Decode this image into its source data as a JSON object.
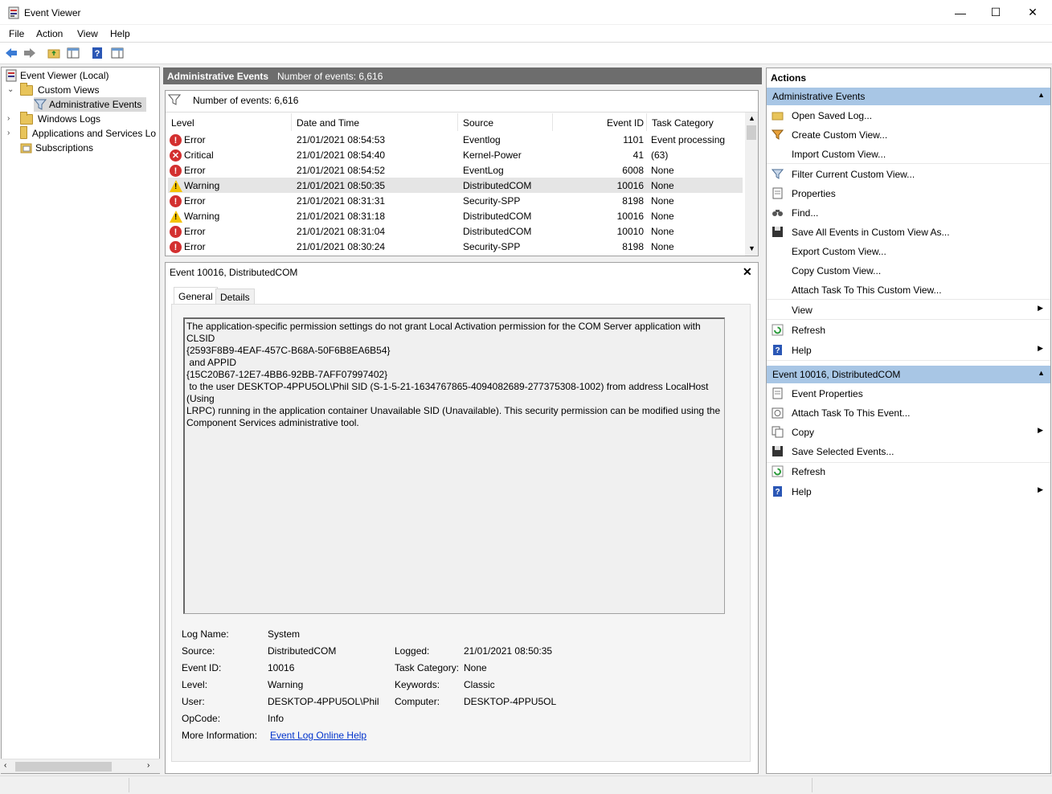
{
  "window": {
    "title": "Event Viewer",
    "minimize": "—",
    "maximize": "☐",
    "close": "✕"
  },
  "menu": [
    "File",
    "Action",
    "View",
    "Help"
  ],
  "tree": {
    "root": "Event Viewer (Local)",
    "custom_views": "Custom Views",
    "admin_events": "Administrative Events",
    "windows_logs": "Windows Logs",
    "apps_services": "Applications and Services Lo",
    "subscriptions": "Subscriptions"
  },
  "center": {
    "header_title": "Administrative Events",
    "header_count": "Number of events: 6,616",
    "filter_count": "Number of events: 6,616",
    "columns": [
      "Level",
      "Date and Time",
      "Source",
      "Event ID",
      "Task Category"
    ],
    "rows": [
      {
        "level": "Error",
        "icon": "error-icon",
        "date": "21/01/2021 08:54:53",
        "source": "Eventlog",
        "id": "1101",
        "cat": "Event processing"
      },
      {
        "level": "Critical",
        "icon": "critical-icon",
        "date": "21/01/2021 08:54:40",
        "source": "Kernel-Power",
        "id": "41",
        "cat": "(63)"
      },
      {
        "level": "Error",
        "icon": "error-icon",
        "date": "21/01/2021 08:54:52",
        "source": "EventLog",
        "id": "6008",
        "cat": "None"
      },
      {
        "level": "Warning",
        "icon": "warning-icon",
        "date": "21/01/2021 08:50:35",
        "source": "DistributedCOM",
        "id": "10016",
        "cat": "None"
      },
      {
        "level": "Error",
        "icon": "error-icon",
        "date": "21/01/2021 08:31:31",
        "source": "Security-SPP",
        "id": "8198",
        "cat": "None"
      },
      {
        "level": "Warning",
        "icon": "warning-icon",
        "date": "21/01/2021 08:31:18",
        "source": "DistributedCOM",
        "id": "10016",
        "cat": "None"
      },
      {
        "level": "Error",
        "icon": "error-icon",
        "date": "21/01/2021 08:31:04",
        "source": "DistributedCOM",
        "id": "10010",
        "cat": "None"
      },
      {
        "level": "Error",
        "icon": "error-icon",
        "date": "21/01/2021 08:30:24",
        "source": "Security-SPP",
        "id": "8198",
        "cat": "None"
      }
    ]
  },
  "detail": {
    "title": "Event 10016, DistributedCOM",
    "tab_general": "General",
    "tab_details": "Details",
    "description": "The application-specific permission settings do not grant Local Activation permission for the COM Server application with\nCLSID\n{2593F8B9-4EAF-457C-B68A-50F6B8EA6B54}\n and APPID\n{15C20B67-12E7-4BB6-92BB-7AFF07997402}\n to the user DESKTOP-4PPU5OL\\Phil SID (S-1-5-21-1634767865-4094082689-277375308-1002) from address LocalHost (Using\nLRPC) running in the application container Unavailable SID (Unavailable). This security permission can be modified using the\nComponent Services administrative tool.",
    "log_name_k": "Log Name:",
    "log_name_v": "System",
    "source_k": "Source:",
    "source_v": "DistributedCOM",
    "logged_k": "Logged:",
    "logged_v": "21/01/2021 08:50:35",
    "event_id_k": "Event ID:",
    "event_id_v": "10016",
    "task_cat_k": "Task Category:",
    "task_cat_v": "None",
    "level_k": "Level:",
    "level_v": "Warning",
    "keywords_k": "Keywords:",
    "keywords_v": "Classic",
    "user_k": "User:",
    "user_v": "DESKTOP-4PPU5OL\\Phil",
    "computer_k": "Computer:",
    "computer_v": "DESKTOP-4PPU5OL",
    "opcode_k": "OpCode:",
    "opcode_v": "Info",
    "more_info_k": "More Information:",
    "more_info_link": "Event Log Online Help"
  },
  "actions": {
    "title": "Actions",
    "section1": "Administrative Events",
    "items1": [
      "Open Saved Log...",
      "Create Custom View...",
      "Import Custom View...",
      "Filter Current Custom View...",
      "Properties",
      "Find...",
      "Save All Events in Custom View As...",
      "Export Custom View...",
      "Copy Custom View...",
      "Attach Task To This Custom View...",
      "View",
      "Refresh",
      "Help"
    ],
    "section2": "Event 10016, DistributedCOM",
    "items2": [
      "Event Properties",
      "Attach Task To This Event...",
      "Copy",
      "Save Selected Events...",
      "Refresh",
      "Help"
    ]
  },
  "colors": {
    "accent_section": "#a8c6e5",
    "header_bg": "#6d6d6d",
    "error": "#d32f2f",
    "warning": "#f5c400"
  }
}
